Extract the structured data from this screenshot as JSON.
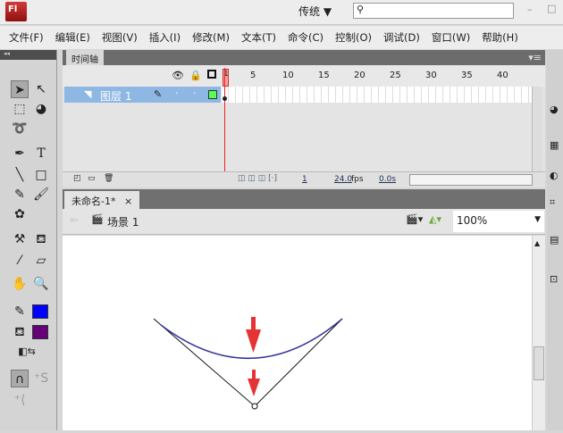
{
  "app": {
    "logo": "Fl",
    "workspace": "传统 ▼",
    "search_placeholder": ""
  },
  "menu": [
    "文件(F)",
    "编辑(E)",
    "视图(V)",
    "插入(I)",
    "修改(M)",
    "文本(T)",
    "命令(C)",
    "控制(O)",
    "调试(D)",
    "窗口(W)",
    "帮助(H)"
  ],
  "timeline": {
    "tab": "时间轴",
    "frame_numbers": [
      "1",
      "5",
      "10",
      "15",
      "20",
      "25",
      "30",
      "35",
      "40"
    ],
    "layer_name": "图层 1",
    "current_frame": "1",
    "fps": "24.0",
    "fps_unit": "fps",
    "time": "0.0s"
  },
  "document": {
    "tab": "未命名-1*",
    "close": "×",
    "scene": "场景 1",
    "zoom": "100%"
  },
  "colors": {
    "stroke": "#0000ff",
    "fill": "#660077",
    "curve": "#333399",
    "arrow": "#e53333"
  }
}
